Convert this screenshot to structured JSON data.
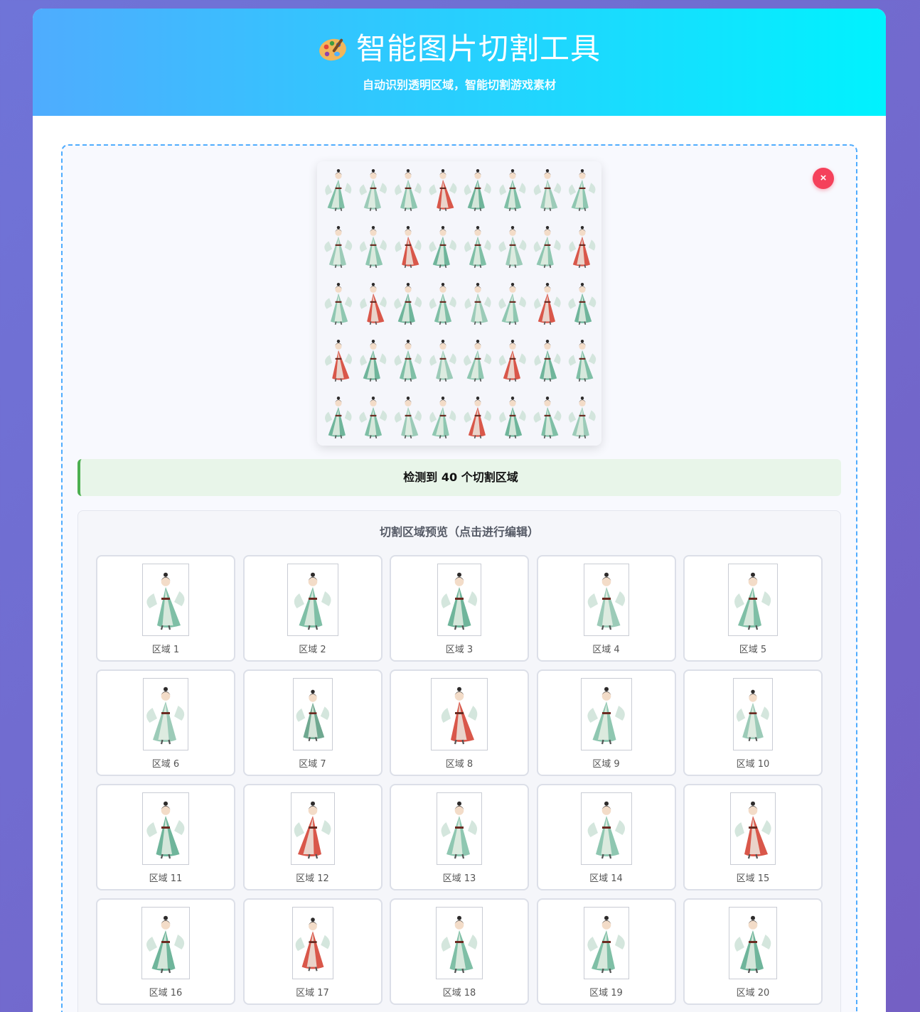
{
  "header": {
    "title": "智能图片切割工具",
    "subtitle": "自动识别透明区域，智能切割游戏素材",
    "icon": "palette-icon"
  },
  "upload": {
    "close_label": "×",
    "status_text": "检测到 40 个切割区域"
  },
  "regions": {
    "title": "切割区域预览（点击进行编辑）",
    "items": [
      {
        "label": "区域 1",
        "robe": "#7fbfa6"
      },
      {
        "label": "区域 2",
        "robe": "#7fbfa6"
      },
      {
        "label": "区域 3",
        "robe": "#6fb59b"
      },
      {
        "label": "区域 4",
        "robe": "#9ccbb8"
      },
      {
        "label": "区域 5",
        "robe": "#7fbfa6"
      },
      {
        "label": "区域 6",
        "robe": "#9ccbb8"
      },
      {
        "label": "区域 7",
        "robe": "#6fa890"
      },
      {
        "label": "区域 8",
        "robe": "#d9574a"
      },
      {
        "label": "区域 9",
        "robe": "#8fc7b1"
      },
      {
        "label": "区域 10",
        "robe": "#9ccbb8"
      },
      {
        "label": "区域 11",
        "robe": "#6fb59b"
      },
      {
        "label": "区域 12",
        "robe": "#d9574a"
      },
      {
        "label": "区域 13",
        "robe": "#8fc7b1"
      },
      {
        "label": "区域 14",
        "robe": "#8fc7b1"
      },
      {
        "label": "区域 15",
        "robe": "#d9574a"
      },
      {
        "label": "区域 16",
        "robe": "#6fb59b"
      },
      {
        "label": "区域 17",
        "robe": "#d9574a"
      },
      {
        "label": "区域 18",
        "robe": "#7fbfa6"
      },
      {
        "label": "区域 19",
        "robe": "#7fbfa6"
      },
      {
        "label": "区域 20",
        "robe": "#6fb59b"
      }
    ]
  },
  "colors": {
    "header_start": "#4facfe",
    "header_end": "#00f2fe",
    "dashed_border": "#4facfe",
    "close_button": "#f5415b",
    "status_bg": "#e8f5e9",
    "status_accent": "#4caf50",
    "jade": "#7fbfa6",
    "crimson": "#d9574a"
  }
}
